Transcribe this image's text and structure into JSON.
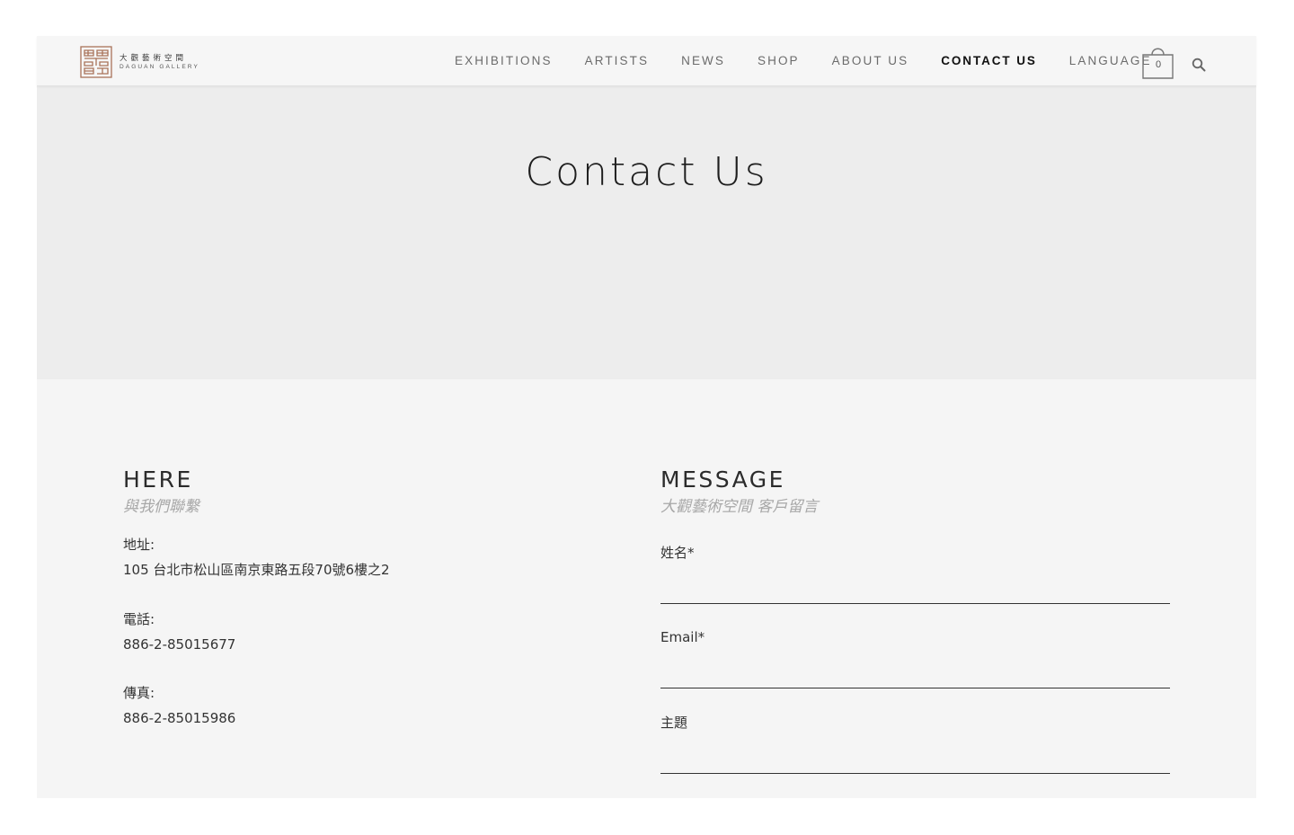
{
  "header": {
    "logo": {
      "chinese_name": "大觀藝術空間",
      "english_name": "DAGUAN GALLERY",
      "brand_color": "#a9735a"
    },
    "nav": [
      {
        "label": "EXHIBITIONS",
        "active": false
      },
      {
        "label": "ARTISTS",
        "active": false
      },
      {
        "label": "NEWS",
        "active": false
      },
      {
        "label": "SHOP",
        "active": false
      },
      {
        "label": "ABOUT US",
        "active": false
      },
      {
        "label": "CONTACT US",
        "active": true
      },
      {
        "label": "LANGUAGE",
        "active": false
      }
    ],
    "cart": {
      "icon": "shopping-bag-icon",
      "count": "0"
    },
    "search": {
      "icon": "search-icon"
    }
  },
  "hero": {
    "title": "Contact Us"
  },
  "contact": {
    "title": "HERE",
    "subtitle": "與我們聯繫",
    "address": {
      "label": "地址:",
      "value": "105 台北市松山區南京東路五段70號6樓之2"
    },
    "phone": {
      "label": "電話:",
      "value": "886-2-85015677"
    },
    "fax": {
      "label": "傳真:",
      "value": "886-2-85015986"
    }
  },
  "message": {
    "title": "MESSAGE",
    "subtitle": "大觀藝術空間 客戶留言",
    "fields": [
      {
        "label": "姓名*",
        "value": ""
      },
      {
        "label": "Email*",
        "value": ""
      },
      {
        "label": "主題",
        "value": ""
      }
    ]
  },
  "colors": {
    "page_background": "#ffffff",
    "content_background": "#f5f5f5",
    "hero_background": "#ededed",
    "nav_text": "#6b6b6b",
    "nav_active": "#111111",
    "subtitle_text": "#a8a8a8"
  }
}
